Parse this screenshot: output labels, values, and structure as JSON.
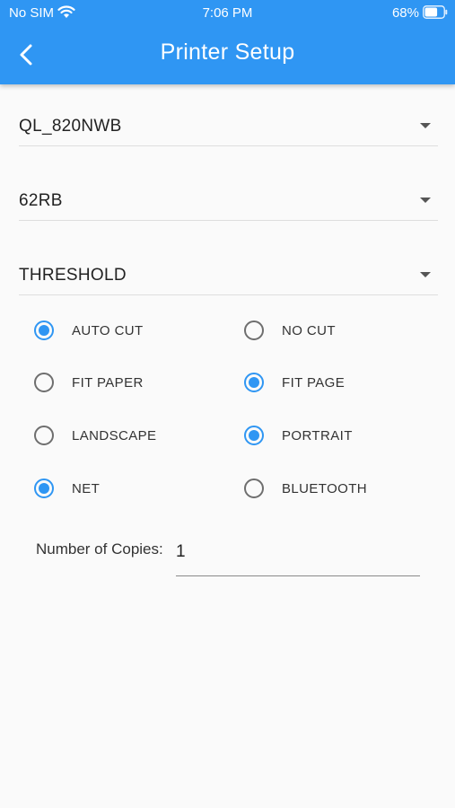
{
  "status_bar": {
    "carrier": "No SIM",
    "time": "7:06 PM",
    "battery": "68%",
    "battery_level": 0.68
  },
  "app_bar": {
    "title": "Printer Setup",
    "color": "#2f96f3"
  },
  "dropdowns": {
    "printer": "QL_820NWB",
    "label": "62RB",
    "mode": "THRESHOLD"
  },
  "options": [
    {
      "label": "AUTO CUT",
      "selected": true
    },
    {
      "label": "NO CUT",
      "selected": false
    },
    {
      "label": "FIT PAPER",
      "selected": false
    },
    {
      "label": "FIT PAGE",
      "selected": true
    },
    {
      "label": "LANDSCAPE",
      "selected": false
    },
    {
      "label": "PORTRAIT",
      "selected": true
    },
    {
      "label": "NET",
      "selected": true
    },
    {
      "label": "BLUETOOTH",
      "selected": false
    }
  ],
  "copies": {
    "label": "Number of Copies:",
    "value": "1"
  }
}
